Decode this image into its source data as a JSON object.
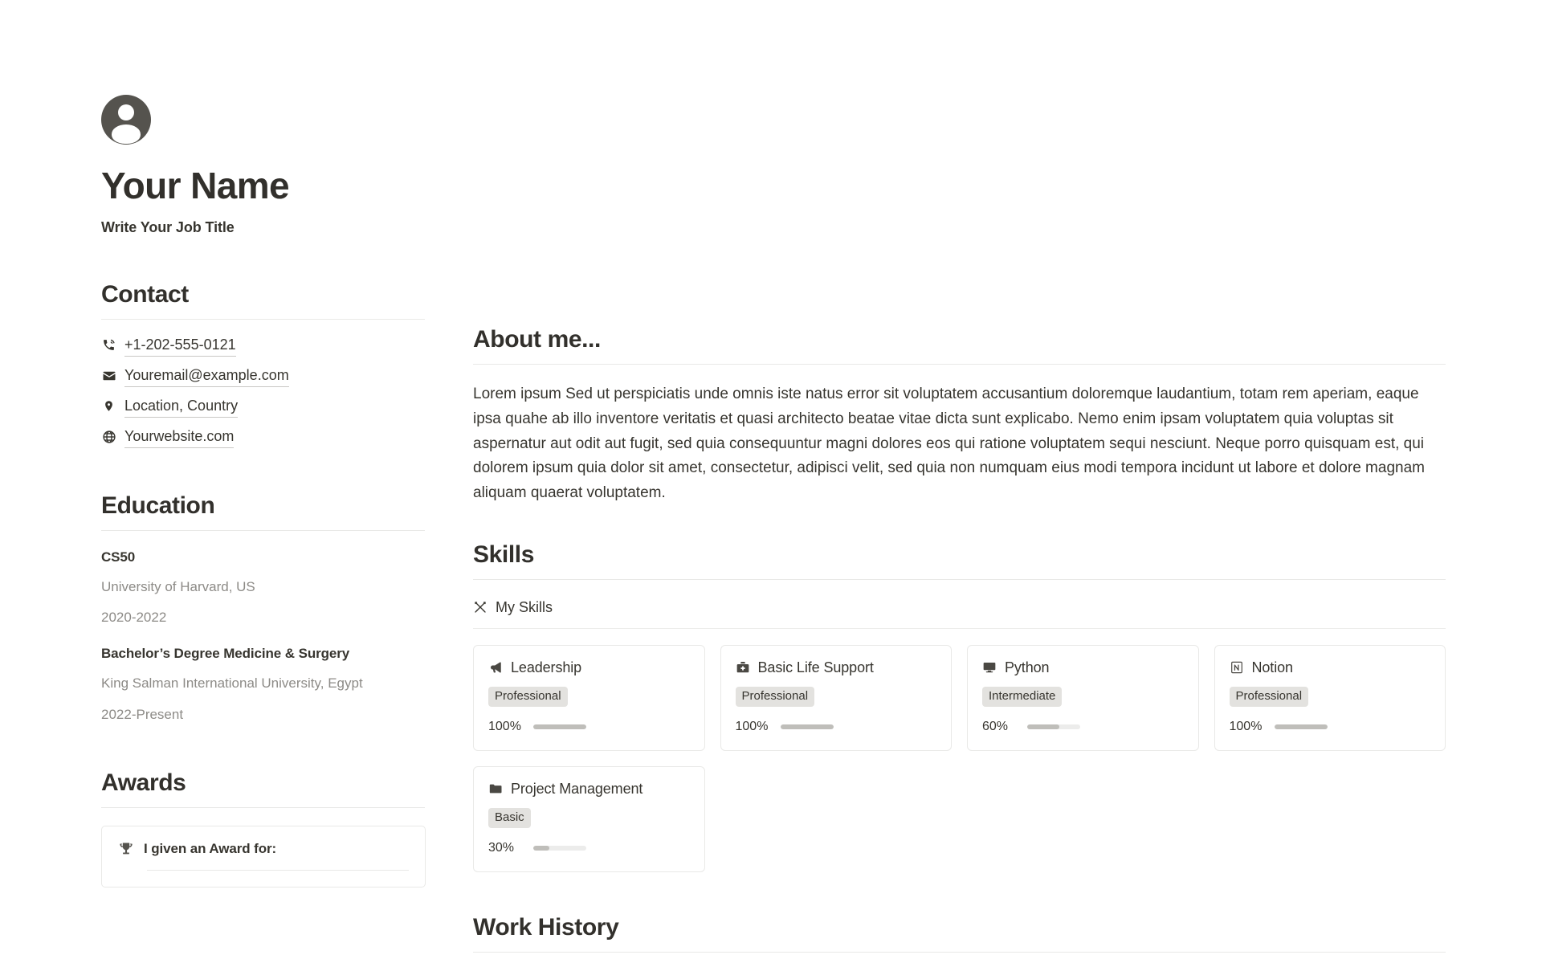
{
  "profile": {
    "avatar_icon": "user-avatar-icon",
    "name": "Your Name",
    "job_title": "Write Your Job Title"
  },
  "sidebar": {
    "contact": {
      "heading": "Contact",
      "items": [
        {
          "icon": "phone-icon",
          "text": "+1-202-555-0121"
        },
        {
          "icon": "envelope-icon",
          "text": "Youremail@example.com"
        },
        {
          "icon": "map-pin-icon",
          "text": "Location, Country"
        },
        {
          "icon": "globe-icon",
          "text": "Yourwebsite.com"
        }
      ]
    },
    "education": {
      "heading": "Education",
      "entries": [
        {
          "degree": "CS50",
          "school": "University of Harvard, US",
          "years": "2020-2022"
        },
        {
          "degree": "Bachelor’s Degree Medicine & Surgery",
          "school": "King Salman International University, Egypt",
          "years": "2022-Present"
        }
      ]
    },
    "awards": {
      "heading": "Awards",
      "card": {
        "icon": "trophy-icon",
        "label": "I given an Award for:"
      }
    }
  },
  "main": {
    "about": {
      "heading": "About me...",
      "body": "Lorem ipsum Sed ut perspiciatis unde omnis iste natus error sit voluptatem accusantium doloremque laudantium, totam rem aperiam, eaque ipsa quahe ab illo inventore veritatis et quasi architecto beatae vitae dicta sunt explicabo. Nemo enim ipsam voluptatem quia voluptas sit aspernatur aut odit aut fugit, sed quia consequuntur magni dolores eos qui ratione voluptatem sequi nesciunt. Neque porro quisquam est, qui dolorem ipsum quia dolor sit amet, consectetur, adipisci velit, sed quia non numquam eius modi tempora incidunt ut labore et dolore magnam aliquam quaerat voluptatem."
    },
    "skills": {
      "heading": "Skills",
      "label_icon": "crossed-arrows-icon",
      "label": "My Skills",
      "cards": [
        {
          "icon": "megaphone-icon",
          "name": "Leadership",
          "level": "Professional",
          "percent": "100%",
          "value": 100
        },
        {
          "icon": "first-aid-kit-icon",
          "name": "Basic Life Support",
          "level": "Professional",
          "percent": "100%",
          "value": 100
        },
        {
          "icon": "desktop-monitor-icon",
          "name": "Python",
          "level": "Intermediate",
          "percent": "60%",
          "value": 60
        },
        {
          "icon": "notion-notebook-icon",
          "name": "Notion",
          "level": "Professional",
          "percent": "100%",
          "value": 100
        },
        {
          "icon": "folder-icon",
          "name": "Project Management",
          "level": "Basic",
          "percent": "30%",
          "value": 30
        }
      ]
    },
    "work_history": {
      "heading": "Work History"
    }
  },
  "colors": {
    "text_primary": "#37352f",
    "text_muted": "#8d8b87",
    "heading": "#32302c",
    "border": "#e9e9e7",
    "badge_bg": "#e3e2df",
    "meter_fill": "#bfbeba",
    "meter_track": "#ececeb",
    "avatar_bg": "#55534e"
  }
}
